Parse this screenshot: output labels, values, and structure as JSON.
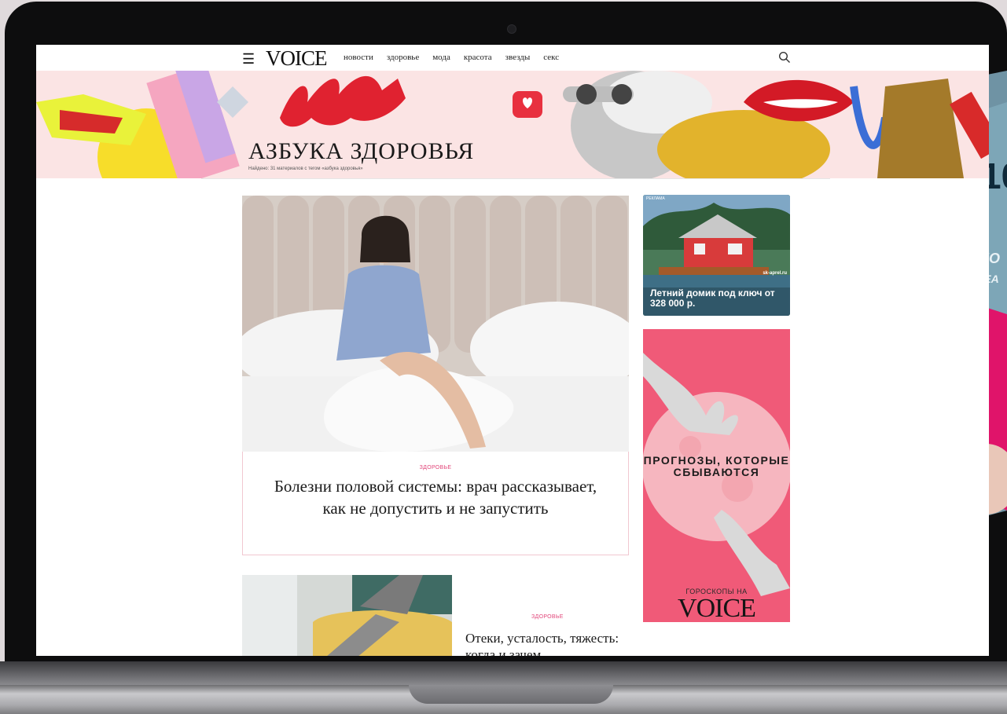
{
  "header": {
    "menu_icon": "hamburger-menu-icon",
    "logo": "VOICE",
    "nav": [
      "новости",
      "здоровье",
      "мода",
      "красота",
      "звезды",
      "секс"
    ],
    "search_icon": "search-icon"
  },
  "banner": {
    "title": "АЗБУКА ЗДОРОВЬЯ",
    "subtitle": "Найдено: 31 материалов с тегом «азбука здоровья»"
  },
  "articles": [
    {
      "tag": "здоровье",
      "title": "Болезни половой системы: врач рассказывает, как не допустить и не запустить"
    },
    {
      "tag": "здоровье",
      "title": "Отеки, усталость, тяжесть: когда и зачем"
    }
  ],
  "ads": {
    "first": {
      "label": "РЕКЛАМА",
      "domain": "sk-aprel.ru",
      "text": "Летний домик под ключ от 328 000 р."
    },
    "second": {
      "text": "ПРОГНОЗЫ, КОТОРЫЕ СБЫВАЮТСЯ",
      "footer": "ГОРОСКОПЫ НА",
      "logo": "VOICE"
    }
  },
  "colors": {
    "accent_pink": "#e2467a",
    "banner_bg": "#fbe4e4",
    "ad_pink": "#f05a78"
  }
}
